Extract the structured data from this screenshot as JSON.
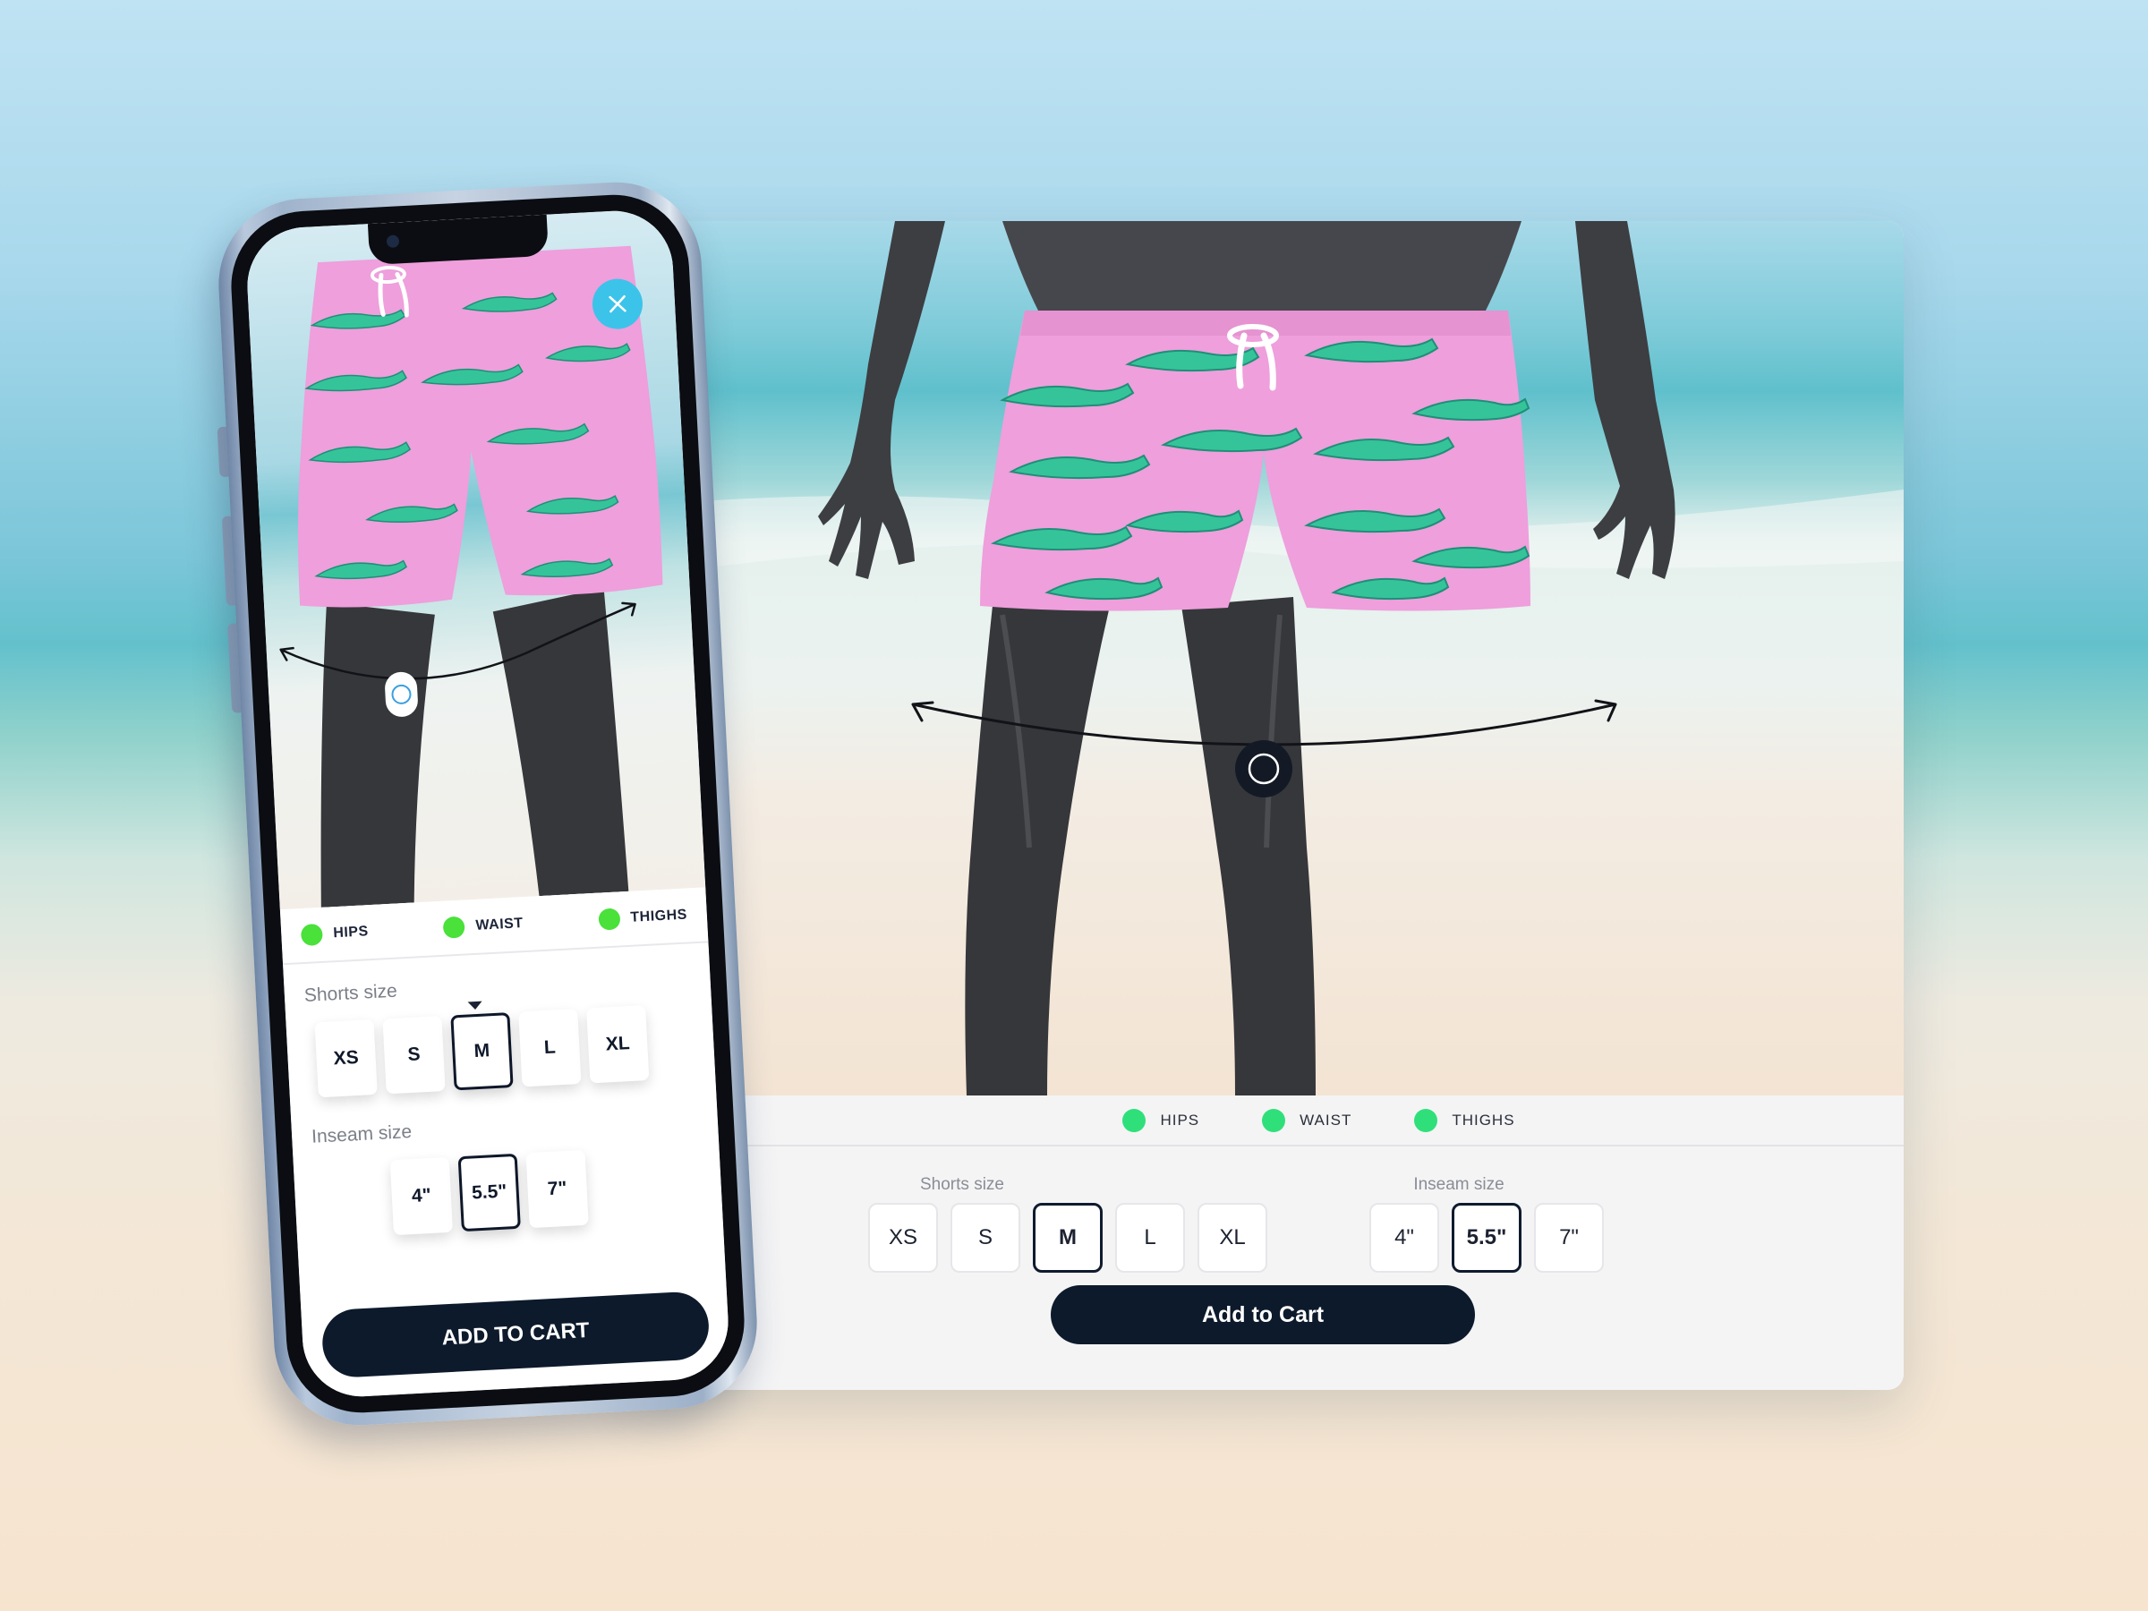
{
  "desktop": {
    "legend": [
      {
        "label": "HIPS",
        "color": "#2fe07a"
      },
      {
        "label": "WAIST",
        "color": "#2fe07a"
      },
      {
        "label": "THIGHS",
        "color": "#2fe07a"
      }
    ],
    "shorts_size": {
      "title": "Shorts size",
      "options": [
        "XS",
        "S",
        "M",
        "L",
        "XL"
      ],
      "selected": "M"
    },
    "inseam_size": {
      "title": "Inseam size",
      "options": [
        "4\"",
        "5.5\"",
        "7\""
      ],
      "selected": "5.5\""
    },
    "add_to_cart": "Add to Cart"
  },
  "phone": {
    "legend": [
      {
        "label": "HIPS",
        "color": "#49e13a"
      },
      {
        "label": "WAIST",
        "color": "#49e13a"
      },
      {
        "label": "THIGHS",
        "color": "#49e13a"
      }
    ],
    "shorts_size": {
      "title": "Shorts size",
      "options": [
        "XS",
        "S",
        "M",
        "L",
        "XL"
      ],
      "selected": "M"
    },
    "inseam_size": {
      "title": "Inseam size",
      "options": [
        "4\"",
        "5.5\"",
        "7\""
      ],
      "selected": "5.5\""
    },
    "add_to_cart": "ADD TO CART"
  },
  "colors": {
    "accent_dark": "#0c1a2c",
    "close_button": "#3cc3ea",
    "shorts_pink": "#ee9fdc",
    "gator_green": "#35c49a",
    "mannequin": "#3a3b3f"
  },
  "icons": [
    "close-icon",
    "measure-handle-icon"
  ]
}
